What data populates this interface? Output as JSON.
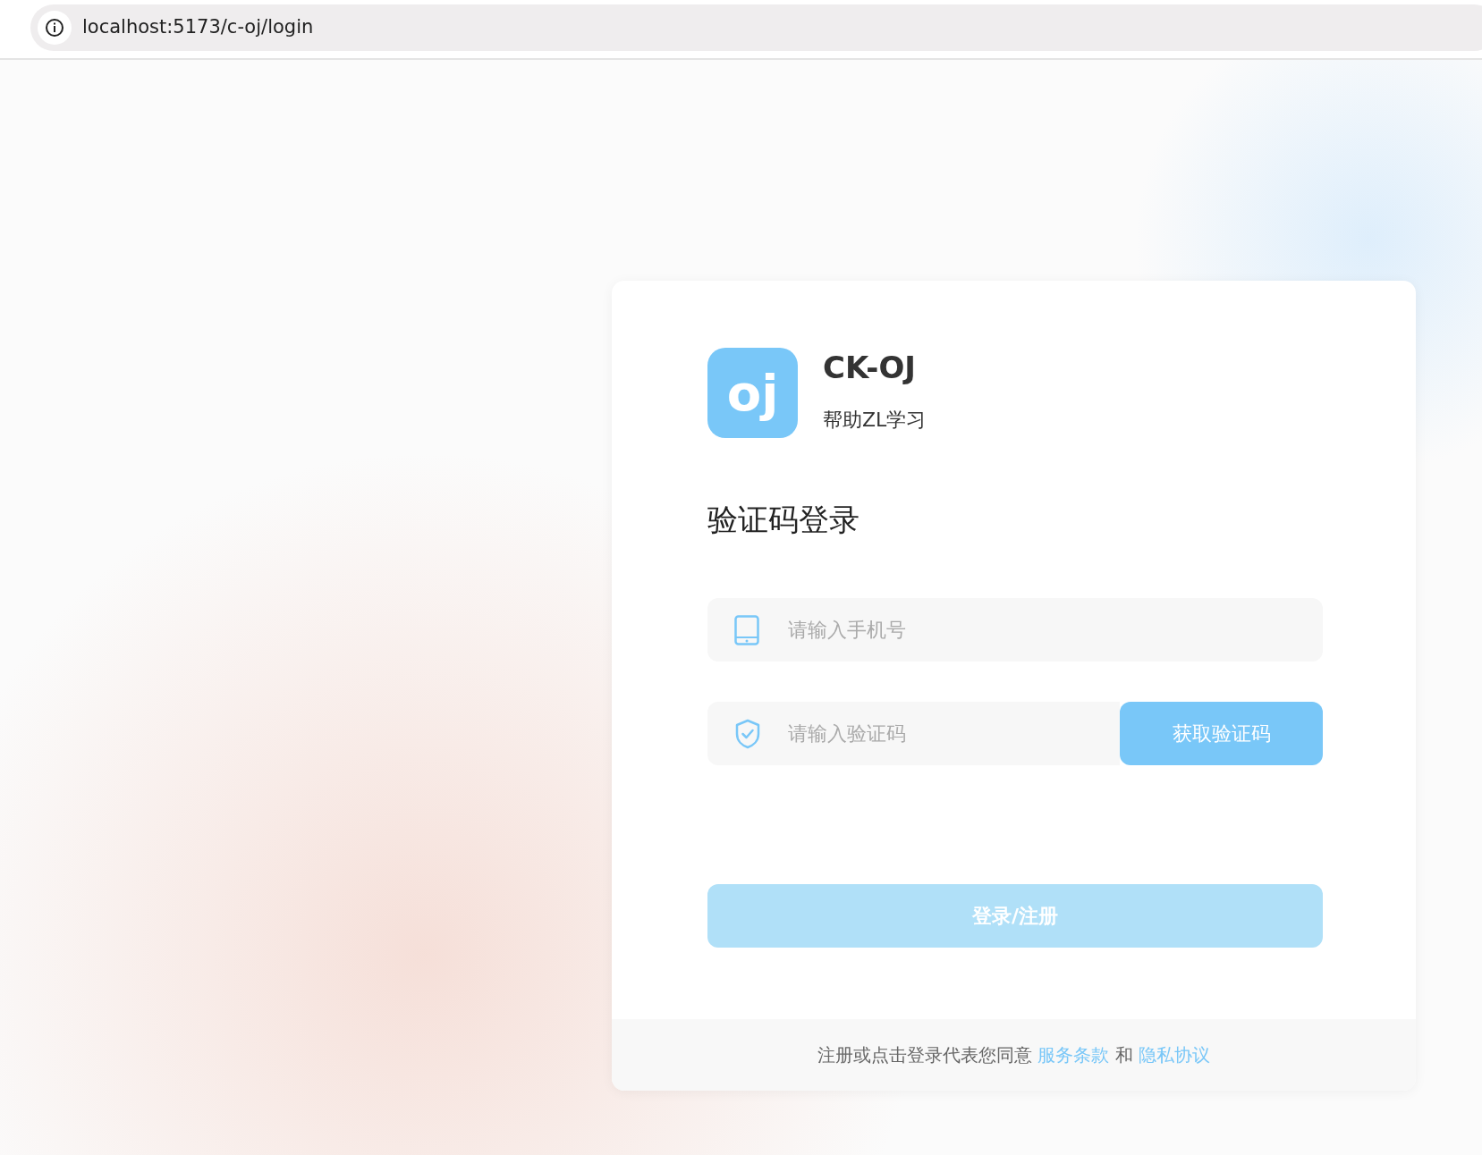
{
  "browser": {
    "address": "localhost:5173/c-oj/login"
  },
  "brand": {
    "logo_text": "oj",
    "name": "CK-OJ",
    "slogan": "帮助ZL学习"
  },
  "heading": "验证码登录",
  "fields": [
    {
      "kind": "phone",
      "placeholder": "请输入手机号"
    },
    {
      "kind": "code",
      "placeholder": "请输入验证码",
      "button": "获取验证码"
    }
  ],
  "submit": {
    "label": "登录/注册",
    "disabled": true
  },
  "footer": {
    "text": "注册或点击登录代表您同意",
    "links": [
      "服务条款",
      "隐私协议"
    ],
    "joiner": "和"
  }
}
